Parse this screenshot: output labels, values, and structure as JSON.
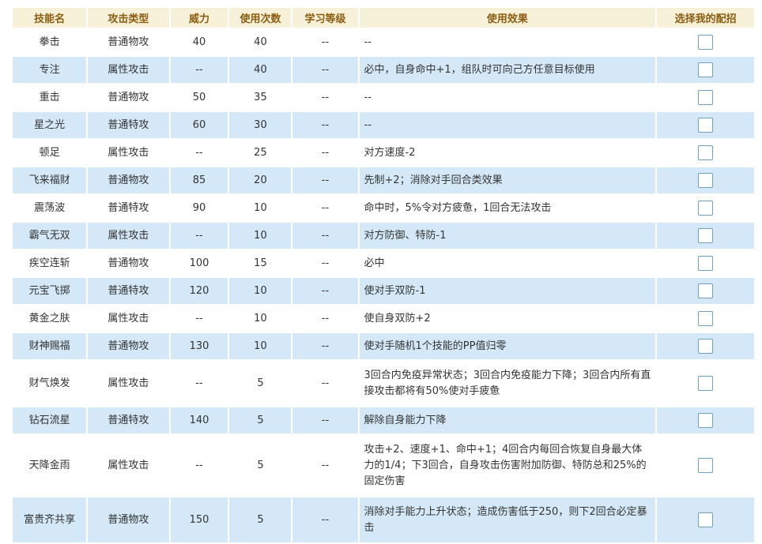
{
  "headers": {
    "name": "技能名",
    "type": "攻击类型",
    "power": "威力",
    "pp": "使用次数",
    "level": "学习等级",
    "effect": "使用效果",
    "select": "选择我的配招"
  },
  "rows": [
    {
      "name": "拳击",
      "type": "普通物攻",
      "power": "40",
      "pp": "40",
      "level": "--",
      "effect": "--",
      "checked": false
    },
    {
      "name": "专注",
      "type": "属性攻击",
      "power": "--",
      "pp": "40",
      "level": "--",
      "effect": "必中，自身命中+1，组队时可向己方任意目标使用",
      "checked": false
    },
    {
      "name": "重击",
      "type": "普通物攻",
      "power": "50",
      "pp": "35",
      "level": "--",
      "effect": "--",
      "checked": false
    },
    {
      "name": "星之光",
      "type": "普通特攻",
      "power": "60",
      "pp": "30",
      "level": "--",
      "effect": "--",
      "checked": false
    },
    {
      "name": "顿足",
      "type": "属性攻击",
      "power": "--",
      "pp": "25",
      "level": "--",
      "effect": "对方速度-2",
      "checked": false
    },
    {
      "name": "飞来福财",
      "type": "普通物攻",
      "power": "85",
      "pp": "20",
      "level": "--",
      "effect": "先制+2；消除对手回合类效果",
      "checked": false
    },
    {
      "name": "震荡波",
      "type": "普通特攻",
      "power": "90",
      "pp": "10",
      "level": "--",
      "effect": "命中时，5%令对方疲惫，1回合无法攻击",
      "checked": false
    },
    {
      "name": "霸气无双",
      "type": "属性攻击",
      "power": "--",
      "pp": "10",
      "level": "--",
      "effect": "对方防御、特防-1",
      "checked": false
    },
    {
      "name": "疾空连斩",
      "type": "普通物攻",
      "power": "100",
      "pp": "15",
      "level": "--",
      "effect": "必中",
      "checked": false
    },
    {
      "name": "元宝飞掷",
      "type": "普通特攻",
      "power": "120",
      "pp": "10",
      "level": "--",
      "effect": "使对手双防-1",
      "checked": false
    },
    {
      "name": "黄金之肤",
      "type": "属性攻击",
      "power": "--",
      "pp": "10",
      "level": "--",
      "effect": "使自身双防+2",
      "checked": false
    },
    {
      "name": "财神赐福",
      "type": "普通物攻",
      "power": "130",
      "pp": "10",
      "level": "--",
      "effect": "使对手随机1个技能的PP值归零",
      "checked": false
    },
    {
      "name": "财气焕发",
      "type": "属性攻击",
      "power": "--",
      "pp": "5",
      "level": "--",
      "effect": "3回合内免疫异常状态；3回合内免疫能力下降；3回合内所有直接攻击都将有50%使对手疲惫",
      "checked": false
    },
    {
      "name": "钻石流星",
      "type": "普通特攻",
      "power": "140",
      "pp": "5",
      "level": "--",
      "effect": "解除自身能力下降",
      "checked": false
    },
    {
      "name": "天降金雨",
      "type": "属性攻击",
      "power": "--",
      "pp": "5",
      "level": "--",
      "effect": "攻击+2、速度+1、命中+1；4回合内每回合恢复自身最大体力的1/4；下3回合，自身攻击伤害附加防御、特防总和25%的固定伤害",
      "checked": false
    },
    {
      "name": "富贵齐共享",
      "type": "普通物攻",
      "power": "150",
      "pp": "5",
      "level": "--",
      "effect": "消除对手能力上升状态；造成伤害低于250，则下2回合必定暴击",
      "checked": false
    }
  ]
}
